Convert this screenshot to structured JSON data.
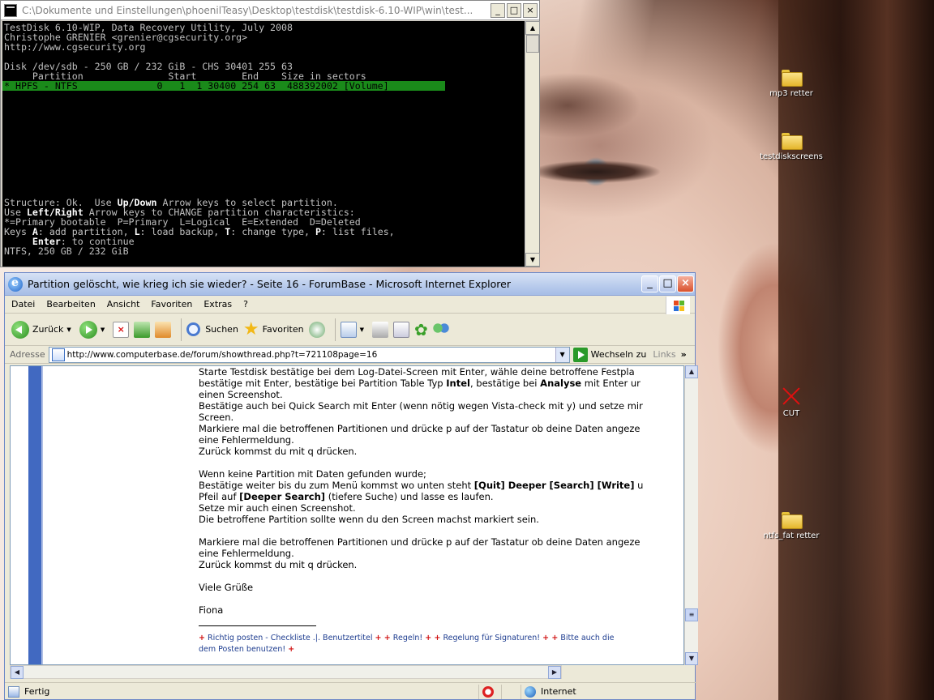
{
  "desktop": {
    "icons": [
      {
        "label": "mp3 retter"
      },
      {
        "label": "testdiskscreens"
      },
      {
        "label": "CUT"
      },
      {
        "label": "ntfs_fat retter"
      }
    ]
  },
  "console": {
    "title": "C:\\Dokumente und Einstellungen\\phoenilTeasy\\Desktop\\testdisk\\testdisk-6.10-WIP\\win\\test...",
    "lines": [
      "TestDisk 6.10-WIP, Data Recovery Utility, July 2008",
      "Christophe GRENIER <grenier@cgsecurity.org>",
      "http://www.cgsecurity.org",
      "",
      "Disk /dev/sdb - 250 GB / 232 GiB - CHS 30401 255 63",
      "     Partition               Start        End    Size in sectors",
      "* HPFS - NTFS              0   1  1 30400 254 63  488392002 [Volume]"
    ],
    "footer": {
      "l1a": "Structure: Ok.  Use ",
      "l1b": "Up/Down",
      "l1c": " Arrow keys to select partition.",
      "l2a": "Use ",
      "l2b": "Left/Right",
      "l2c": " Arrow keys to CHANGE partition characteristics:",
      "l3": "*=Primary bootable  P=Primary  L=Logical  E=Extended  D=Deleted",
      "l4a": "Keys ",
      "l4b": "A",
      "l4c": ": add partition, ",
      "l4d": "L",
      "l4e": ": load backup, ",
      "l4f": "T",
      "l4g": ": change type, ",
      "l4h": "P",
      "l4i": ": list files,",
      "l5a": "     ",
      "l5b": "Enter",
      "l5c": ": to continue",
      "l6": "NTFS, 250 GB / 232 GiB"
    }
  },
  "browser": {
    "title": "Partition gelöscht, wie krieg ich sie wieder? - Seite 16 - ForumBase - Microsoft Internet Explorer",
    "menu": [
      "Datei",
      "Bearbeiten",
      "Ansicht",
      "Favoriten",
      "Extras",
      "?"
    ],
    "toolbar": {
      "back": "Zurück",
      "search": "Suchen",
      "favorites": "Favoriten"
    },
    "address_label": "Adresse",
    "url": "http://www.computerbase.de/forum/showthread.php?t=721108page=16",
    "go_label": "Wechseln zu",
    "links_label": "Links",
    "status_text": "Fertig",
    "zone_text": "Internet",
    "post": {
      "p1a": "Starte Testdisk bestätige bei dem Log-Datei-Screen mit Enter, wähle deine betroffene Festpla",
      "p2a": "bestätige mit Enter, bestätige bei Partition Table Typ ",
      "p2b": "Intel",
      "p2c": ", bestätige bei ",
      "p2d": "Analyse",
      "p2e": " mit Enter ur",
      "p3": "einen Screenshot.",
      "p4": "Bestätige auch bei Quick Search mit Enter (wenn nötig wegen Vista-check mit y) und setze mir",
      "p5": "Screen.",
      "p6": "Markiere mal die betroffenen Partitionen und drücke p auf der Tastatur ob deine Daten angeze",
      "p7": "eine Fehlermeldung.",
      "p8": "Zurück kommst du mit q drücken.",
      "p9": "Wenn keine Partition mit Daten gefunden wurde;",
      "p10a": "Bestätige weiter bis du zum Menü kommst wo unten steht ",
      "p10b": "[Quit] Deeper [Search] [Write]",
      "p10c": " u",
      "p11a": "Pfeil auf ",
      "p11b": "[Deeper Search]",
      "p11c": " (tiefere Suche) und lasse es laufen.",
      "p12": "Setze mir auch einen Screenshot.",
      "p13": "Die betroffene Partition sollte wenn du den Screen machst markiert sein.",
      "p14": "Markiere mal die betroffenen Partitionen und drücke p auf der Tastatur ob deine Daten angeze",
      "p15": "eine Fehlermeldung.",
      "p16": "Zurück kommst du mit q drücken.",
      "p17": "Viele Grüße",
      "p18": "Fiona"
    },
    "signature": {
      "s1": "Richtig posten - Checkliste .|. Benutzertitel",
      "s2": "Regeln!",
      "s3": "Regelung für Signaturen!",
      "s4": "Bitte auch die",
      "s5": "dem Posten benutzen!"
    }
  }
}
